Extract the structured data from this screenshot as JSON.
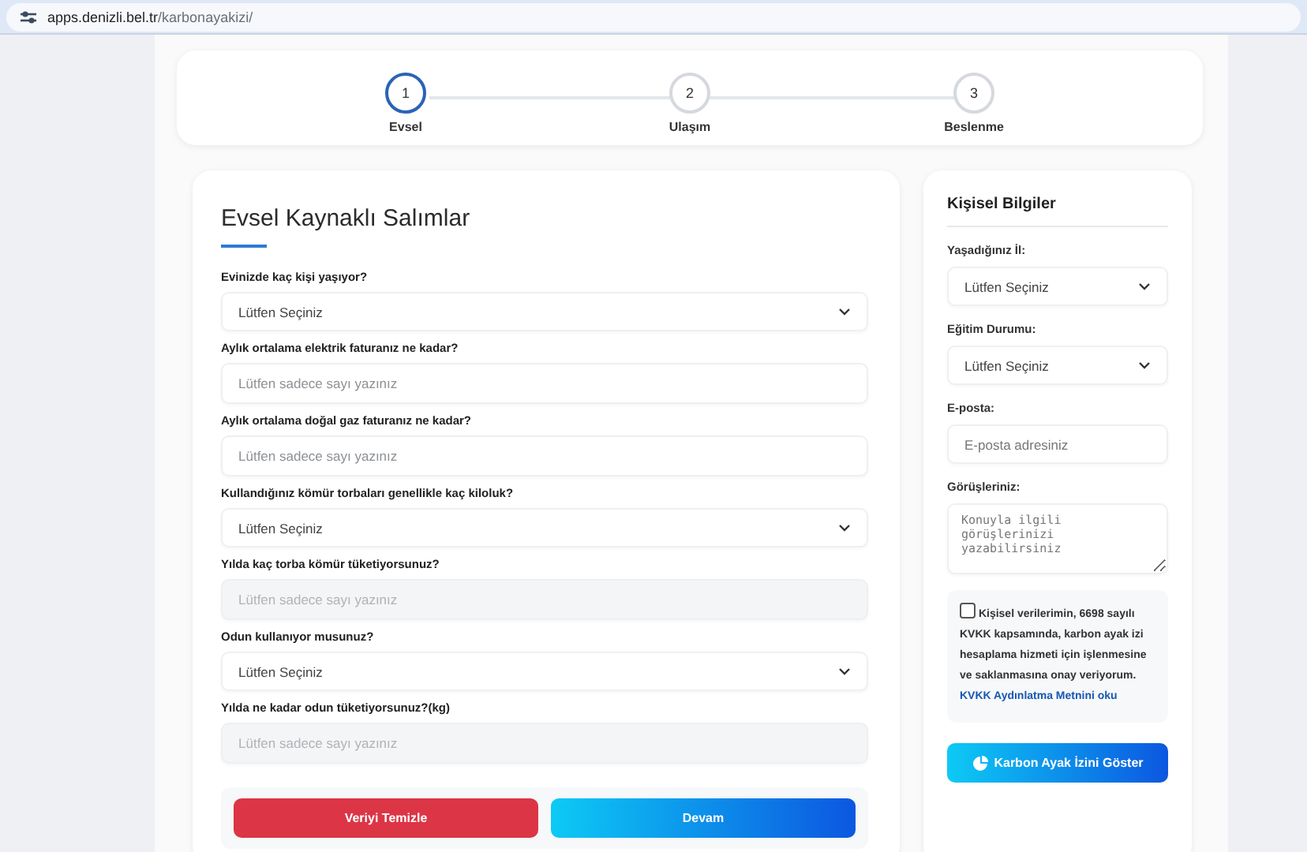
{
  "address_bar": {
    "host": "apps.denizli.bel.tr",
    "path": "/karbonayakizi/"
  },
  "steps": [
    {
      "number": "1",
      "label": "Evsel",
      "selected": true
    },
    {
      "number": "2",
      "label": "Ulaşım",
      "selected": false
    },
    {
      "number": "3",
      "label": "Beslenme",
      "selected": false
    }
  ],
  "form": {
    "title": "Evsel Kaynaklı Salımlar",
    "fields": [
      {
        "label": "Evinizde kaç kişi yaşıyor?",
        "kind": "select",
        "value": "Lütfen Seçiniz"
      },
      {
        "label": "Aylık ortalama elektrik faturanız ne kadar?",
        "kind": "input",
        "placeholder": "Lütfen sadece sayı yazınız",
        "disabled": false
      },
      {
        "label": "Aylık ortalama doğal gaz faturanız ne kadar?",
        "kind": "input",
        "placeholder": "Lütfen sadece sayı yazınız",
        "disabled": false
      },
      {
        "label": "Kullandığınız kömür torbaları genellikle kaç kiloluk?",
        "kind": "select",
        "value": "Lütfen Seçiniz"
      },
      {
        "label": "Yılda kaç torba kömür tüketiyorsunuz?",
        "kind": "input",
        "placeholder": "Lütfen sadece sayı yazınız",
        "disabled": true
      },
      {
        "label": "Odun kullanıyor musunuz?",
        "kind": "select",
        "value": "Lütfen Seçiniz"
      },
      {
        "label": "Yılda ne kadar odun tüketiyorsunuz?(kg)",
        "kind": "input",
        "placeholder": "Lütfen sadece sayı yazınız",
        "disabled": true
      }
    ],
    "buttons": [
      {
        "label": "Veriyi Temizle",
        "kind": "danger"
      },
      {
        "label": "Devam",
        "kind": "primary"
      }
    ]
  },
  "personal": {
    "title": "Kişisel Bilgiler",
    "fields": [
      {
        "label": "Yaşadığınız İl:",
        "kind": "select",
        "value": "Lütfen Seçiniz"
      },
      {
        "label": "Eğitim Durumu:",
        "kind": "select",
        "value": "Lütfen Seçiniz"
      },
      {
        "label": "E-posta:",
        "kind": "input",
        "placeholder": "E-posta adresiniz"
      },
      {
        "label": "Görüşleriniz:",
        "kind": "textarea",
        "placeholder": "Konuyla ilgili görüşlerinizi yazabilirsiniz"
      }
    ],
    "consent": {
      "checked": false,
      "text": "Kişisel verilerimin, 6698 sayılı KVKK kapsamında, karbon ayak izi hesaplama hizmeti için işlenmesine ve saklanmasına onay veriyorum.",
      "link": "KVKK Aydınlatma Metnini oku"
    },
    "submit": "Karbon Ayak İzini Göster"
  }
}
